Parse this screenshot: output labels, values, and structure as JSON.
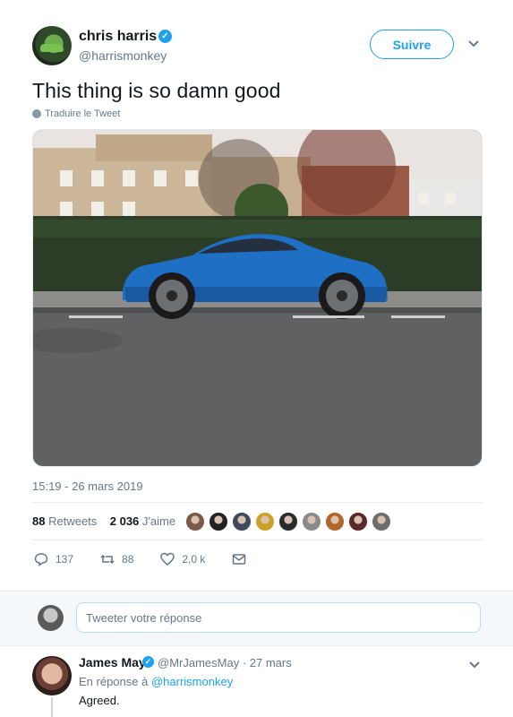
{
  "tweet": {
    "author_name": "chris harris",
    "author_handle": "@harrismonkey",
    "follow_label": "Suivre",
    "text": "This thing is so damn good",
    "translate_label": "Traduire le Tweet",
    "timestamp": "15:19 - 26 mars 2019",
    "retweets_count": "88",
    "retweets_label": "Retweets",
    "likes_count": "2 036",
    "likes_label": "J'aime",
    "reply_count": "137",
    "retweet_action_count": "88",
    "like_action_count": "2,0 k",
    "photo_icon": "car-photo",
    "liker_colors": [
      "#7a5a48",
      "#222222",
      "#3f4a5c",
      "#c9a227",
      "#2b2b2b",
      "#8a8a8a",
      "#b2652a",
      "#5a2a2a",
      "#6e6e6e"
    ]
  },
  "reply_box": {
    "placeholder": "Tweeter votre réponse"
  },
  "reply": {
    "author_name": "James May",
    "author_handle": "@MrJamesMay · 27 mars",
    "reply_to_prefix": "En réponse à",
    "reply_to_handle": "@harrismonkey",
    "text": "Agreed."
  },
  "colors": {
    "accent": "#1da1f2",
    "muted": "#657786"
  }
}
